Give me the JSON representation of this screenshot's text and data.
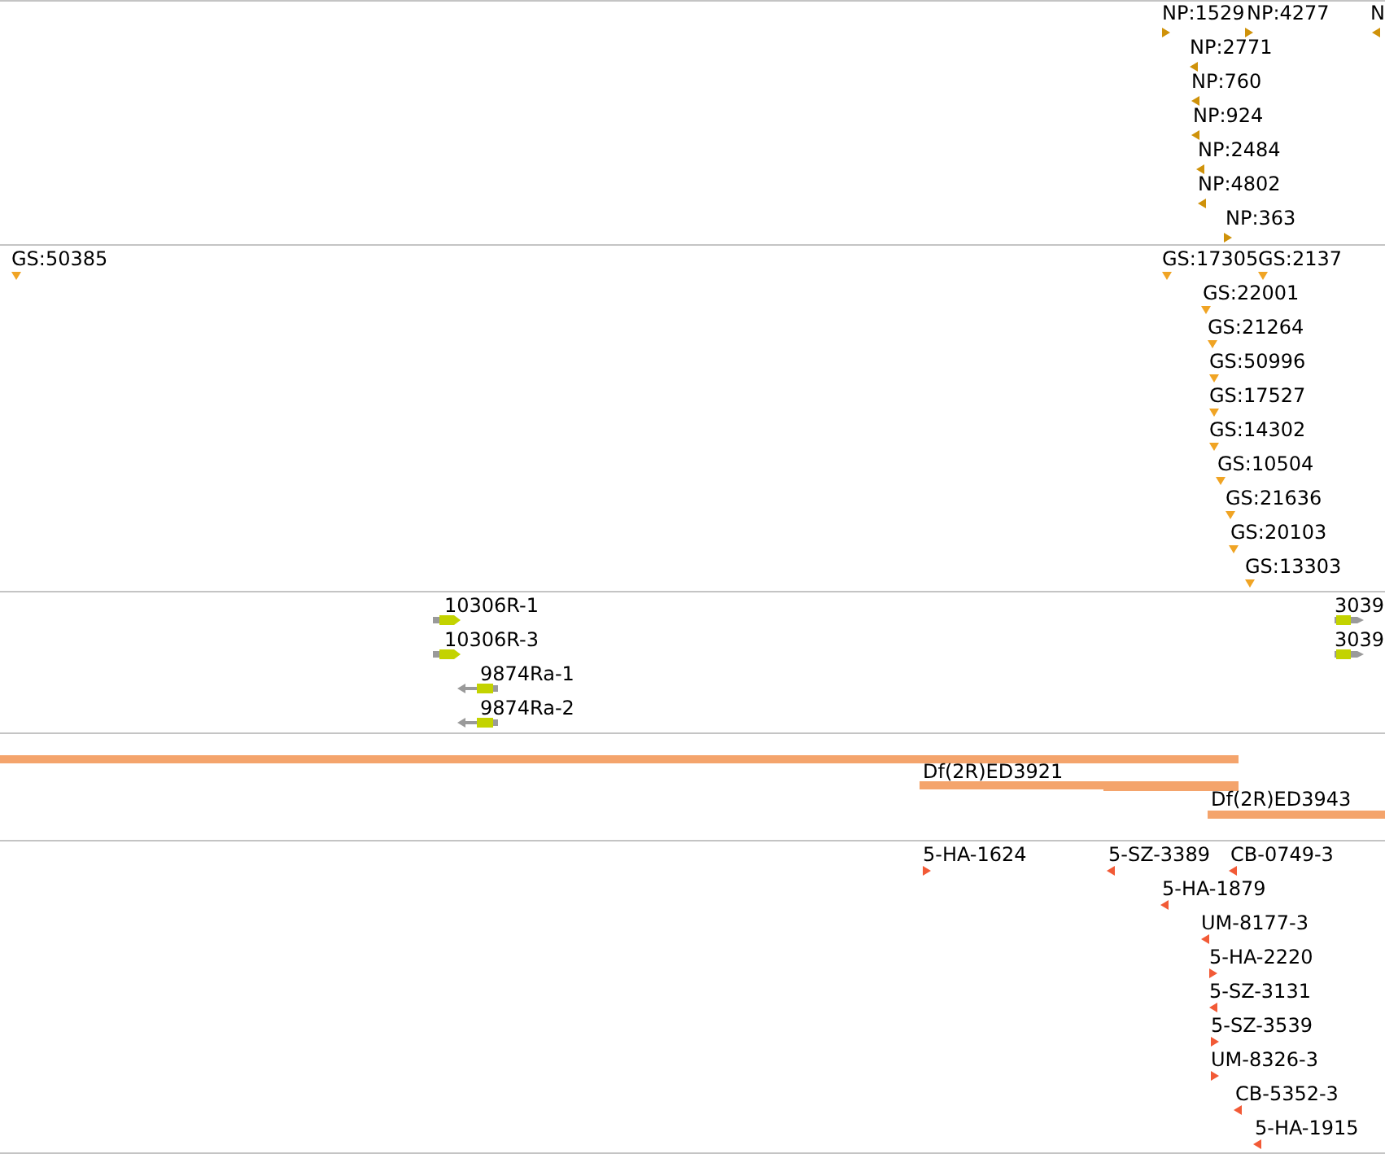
{
  "tracks": [
    {
      "kind": "stranded",
      "color": "#cf920a",
      "features": [
        {
          "label": "NP:1529",
          "reverse": false
        },
        {
          "label": "NP:4277",
          "reverse": false
        },
        {
          "label": "N",
          "reverse": true
        },
        {
          "label": "NP:2771",
          "reverse": true
        },
        {
          "label": "NP:760",
          "reverse": true
        },
        {
          "label": "NP:924",
          "reverse": true
        },
        {
          "label": "NP:2484",
          "reverse": true
        },
        {
          "label": "NP:4802",
          "reverse": true
        },
        {
          "label": "NP:363",
          "reverse": false
        }
      ]
    },
    {
      "kind": "points",
      "color": "#f0a424",
      "features": [
        {
          "label": "GS:50385"
        },
        {
          "label": "GS:17305"
        },
        {
          "label": "GS:2137"
        },
        {
          "label": "GS:22001"
        },
        {
          "label": "GS:21264"
        },
        {
          "label": "GS:50996"
        },
        {
          "label": "GS:17527"
        },
        {
          "label": "GS:14302"
        },
        {
          "label": "GS:10504"
        },
        {
          "label": "GS:21636"
        },
        {
          "label": "GS:20103"
        },
        {
          "label": "GS:13303"
        }
      ]
    },
    {
      "kind": "amplicons",
      "features": [
        {
          "label": "10306R-1",
          "reverse": false
        },
        {
          "label": "3039",
          "reverse": false
        },
        {
          "label": "10306R-3",
          "reverse": false
        },
        {
          "label": "3039",
          "reverse": false
        },
        {
          "label": "9874Ra-1",
          "reverse": true
        },
        {
          "label": "9874Ra-2",
          "reverse": true
        }
      ]
    },
    {
      "kind": "deletions",
      "features": [
        {
          "kind": "bar"
        },
        {
          "kind": "labeled",
          "label": "Df(2R)ED3921"
        },
        {
          "kind": "bar"
        },
        {
          "kind": "labeled",
          "label": "Df(2R)ED3943"
        }
      ]
    },
    {
      "kind": "stranded",
      "color": "#f25a36",
      "features": [
        {
          "label": "5-HA-1624",
          "reverse": false
        },
        {
          "label": "5-SZ-3389",
          "reverse": true
        },
        {
          "label": "CB-0749-3",
          "reverse": true
        },
        {
          "label": "5-HA-1879",
          "reverse": true
        },
        {
          "label": "UM-8177-3",
          "reverse": true
        },
        {
          "label": "5-HA-2220",
          "reverse": false
        },
        {
          "label": "5-SZ-3131",
          "reverse": true
        },
        {
          "label": "5-SZ-3539",
          "reverse": false
        },
        {
          "label": "UM-8326-3",
          "reverse": false
        },
        {
          "label": "CB-5352-3",
          "reverse": true
        },
        {
          "label": "5-HA-1915",
          "reverse": true
        }
      ]
    }
  ]
}
